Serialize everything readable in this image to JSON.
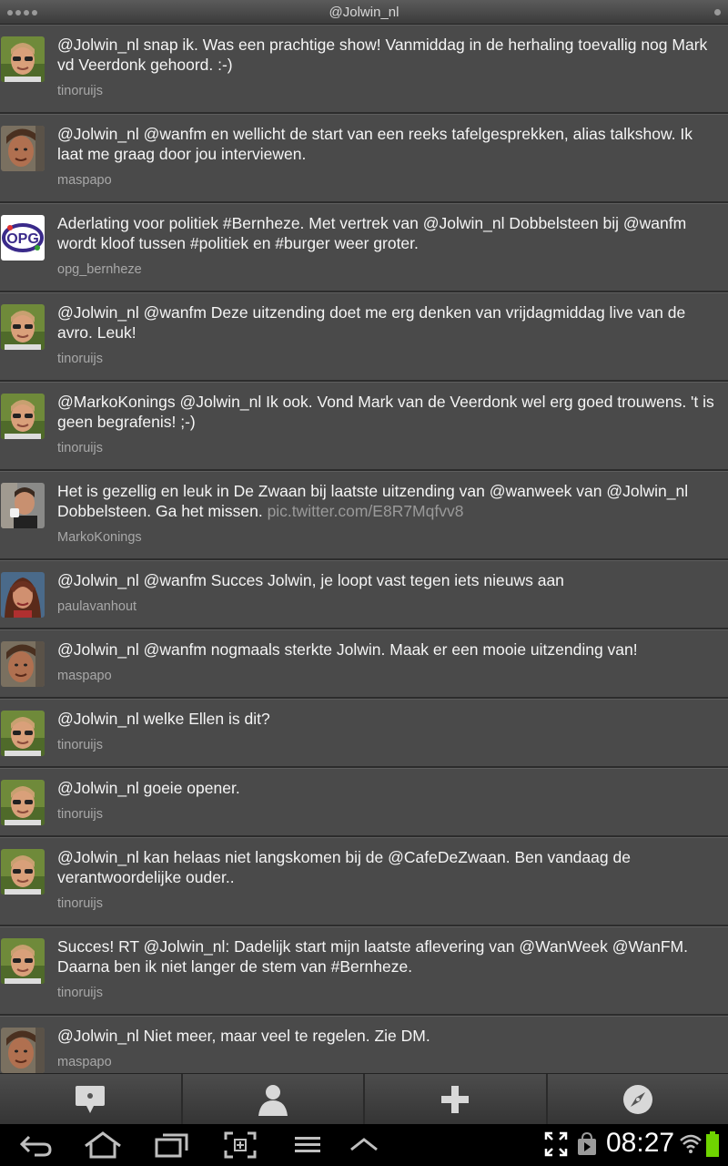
{
  "header": {
    "title": "@Jolwin_nl"
  },
  "tweets": [
    {
      "text": "@Jolwin_nl snap ik. Was een prachtige show! Vanmiddag in de herhaling toevallig nog Mark vd Veerdonk gehoord. :-)",
      "author": "tinoruijs"
    },
    {
      "text": "@Jolwin_nl @wanfm en wellicht de start van een reeks tafelgesprekken, alias talkshow. Ik laat me graag door jou interviewen.",
      "author": "maspapo"
    },
    {
      "text": "Aderlating voor politiek #Bernheze. Met vertrek van @Jolwin_nl Dobbelsteen bij @wanfm wordt kloof tussen #politiek en #burger weer groter.",
      "author": "opg_bernheze"
    },
    {
      "text": "@Jolwin_nl @wanfm Deze uitzending doet me erg denken van vrijdagmiddag live van de avro. Leuk!",
      "author": "tinoruijs"
    },
    {
      "text": "@MarkoKonings @Jolwin_nl Ik ook. Vond Mark van de Veerdonk wel erg goed trouwens. 't is geen begrafenis! ;-)",
      "author": "tinoruijs"
    },
    {
      "text": "Het is gezellig en leuk in De Zwaan bij laatste uitzending van @wanweek van @Jolwin_nl Dobbelsteen. Ga het missen.",
      "link": "pic.twitter.com/E8R7Mqfvv8",
      "author": "MarkoKonings"
    },
    {
      "text": "@Jolwin_nl @wanfm Succes Jolwin, je loopt vast tegen iets nieuws aan",
      "author": "paulavanhout"
    },
    {
      "text": "@Jolwin_nl @wanfm nogmaals sterkte Jolwin. Maak er een mooie uitzending van!",
      "author": "maspapo"
    },
    {
      "text": "@Jolwin_nl welke Ellen is dit?",
      "author": "tinoruijs"
    },
    {
      "text": "@Jolwin_nl goeie opener.",
      "author": "tinoruijs"
    },
    {
      "text": "@Jolwin_nl kan helaas niet langskomen bij de @CafeDeZwaan. Ben vandaag de verantwoordelijke ouder..",
      "author": "tinoruijs"
    },
    {
      "text": "Succes! RT @Jolwin_nl: Dadelijk start mijn laatste aflevering van @WanWeek @WanFM. Daarna ben ik niet langer de stem van #Bernheze.",
      "author": "tinoruijs"
    },
    {
      "text": "@Jolwin_nl Niet meer, maar veel te regelen. Zie DM.",
      "author": "maspapo"
    }
  ],
  "opg_logo_text": "OPG",
  "tabbar": {
    "icons": [
      "messages-icon",
      "profile-icon",
      "add-icon",
      "compass-icon"
    ]
  },
  "statusbar": {
    "time": "08:27"
  },
  "colors": {
    "background": "#4a4a4a",
    "author": "#a8a8a8",
    "link": "#9a9a9a",
    "battery": "#6fd400"
  }
}
